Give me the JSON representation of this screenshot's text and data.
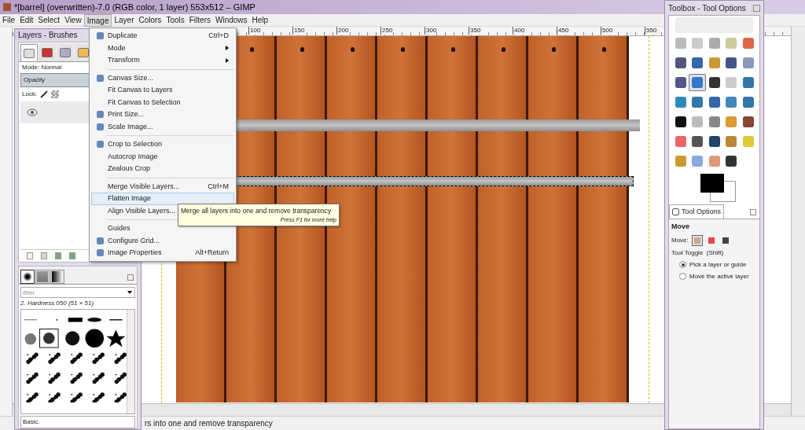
{
  "window": {
    "title": "*[barrel] (overwritten)-7.0 (RGB color, 1 layer) 553x512 – GIMP"
  },
  "menubar": [
    {
      "label": "File",
      "selected": false
    },
    {
      "label": "Edit",
      "selected": false
    },
    {
      "label": "Select",
      "selected": false
    },
    {
      "label": "View",
      "selected": false
    },
    {
      "label": "Image",
      "selected": true
    },
    {
      "label": "Layer",
      "selected": false
    },
    {
      "label": "Colors",
      "selected": false
    },
    {
      "label": "Tools",
      "selected": false
    },
    {
      "label": "Filters",
      "selected": false
    },
    {
      "label": "Windows",
      "selected": false
    },
    {
      "label": "Help",
      "selected": false
    }
  ],
  "layers_dock": {
    "title": "Layers - Brushes",
    "tabs": [
      {
        "selected": true
      },
      {
        "selected": false
      },
      {
        "selected": false
      },
      {
        "selected": false
      }
    ],
    "mode": "Mode: Normal",
    "opacity": {
      "label": "Opacity",
      "level": 1
    },
    "lock": "Lock:",
    "layer_visible": true,
    "brush_tabs": [
      {
        "selected": true
      },
      {
        "selected": false
      },
      {
        "selected": false
      }
    ],
    "filter_placeholder": "filter",
    "brush_name": "2. Hardness 050 (51 × 51)",
    "preset": "Basic."
  },
  "image_menu": [
    {
      "kind": "item",
      "label": "Duplicate",
      "shortcut": "Ctrl+D",
      "has_icon": true,
      "submenu": false,
      "highlighted": false
    },
    {
      "kind": "item",
      "label": "Mode",
      "has_icon": false,
      "submenu": true,
      "highlighted": false
    },
    {
      "kind": "item",
      "label": "Transform",
      "has_icon": false,
      "submenu": true,
      "highlighted": false
    },
    {
      "kind": "separator"
    },
    {
      "kind": "item",
      "label": "Canvas Size...",
      "has_icon": true,
      "submenu": false,
      "highlighted": false
    },
    {
      "kind": "item",
      "label": "Fit Canvas to Layers",
      "has_icon": false,
      "submenu": false,
      "highlighted": false
    },
    {
      "kind": "item",
      "label": "Fit Canvas to Selection",
      "has_icon": false,
      "submenu": false,
      "highlighted": false
    },
    {
      "kind": "item",
      "label": "Print Size...",
      "has_icon": true,
      "submenu": false,
      "highlighted": false
    },
    {
      "kind": "item",
      "label": "Scale Image...",
      "has_icon": true,
      "submenu": false,
      "highlighted": false
    },
    {
      "kind": "separator"
    },
    {
      "kind": "item",
      "label": "Crop to Selection",
      "has_icon": true,
      "submenu": false,
      "highlighted": false
    },
    {
      "kind": "item",
      "label": "Autocrop Image",
      "has_icon": false,
      "submenu": false,
      "highlighted": false
    },
    {
      "kind": "item",
      "label": "Zealous Crop",
      "has_icon": false,
      "submenu": false,
      "highlighted": false
    },
    {
      "kind": "separator"
    },
    {
      "kind": "item",
      "label": "Merge Visible Layers...",
      "shortcut": "Ctrl+M",
      "has_icon": false,
      "submenu": false,
      "highlighted": false
    },
    {
      "kind": "item",
      "label": "Flatten Image",
      "has_icon": false,
      "submenu": false,
      "highlighted": true
    },
    {
      "kind": "item",
      "label": "Align Visible Layers...",
      "has_icon": false,
      "submenu": false,
      "highlighted": false
    },
    {
      "kind": "separator"
    },
    {
      "kind": "item",
      "label": "Guides",
      "has_icon": false,
      "submenu": false,
      "highlighted": false
    },
    {
      "kind": "item",
      "label": "Configure Grid...",
      "has_icon": true,
      "submenu": false,
      "highlighted": false
    },
    {
      "kind": "item",
      "label": "Image Properties",
      "shortcut": "Alt+Return",
      "has_icon": true,
      "submenu": false,
      "highlighted": false
    }
  ],
  "tooltip": {
    "text": "Merge all layers into one and remove transparency",
    "help": "Press F1 for more help"
  },
  "ruler_labels": [
    "100",
    "150",
    "200",
    "250",
    "300",
    "350",
    "400",
    "450",
    "500",
    "550"
  ],
  "status_bar": {
    "text": "rs into one and remove transparency"
  },
  "toolbox": {
    "title": "Toolbox - Tool Options",
    "tools": [
      {
        "selected": false
      },
      {
        "selected": false
      },
      {
        "selected": false
      },
      {
        "selected": false
      },
      {
        "selected": false
      },
      {
        "selected": false
      },
      {
        "selected": false
      },
      {
        "selected": false
      },
      {
        "selected": false
      },
      {
        "selected": false
      },
      {
        "selected": false
      },
      {
        "selected": true
      },
      {
        "selected": false
      },
      {
        "selected": false
      },
      {
        "selected": false
      },
      {
        "selected": false
      },
      {
        "selected": false
      },
      {
        "selected": false
      },
      {
        "selected": false
      },
      {
        "selected": false
      },
      {
        "selected": false
      },
      {
        "selected": false
      },
      {
        "selected": false
      },
      {
        "selected": false
      },
      {
        "selected": false
      },
      {
        "selected": false
      },
      {
        "selected": false
      },
      {
        "selected": false
      },
      {
        "selected": false
      },
      {
        "selected": false
      },
      {
        "selected": false
      },
      {
        "selected": false
      },
      {
        "selected": false
      },
      {
        "selected": false
      }
    ],
    "options_tab": "Tool Options",
    "tool_name": "Move",
    "move_label": "Move:",
    "move_modes": [
      {
        "selected": true
      },
      {
        "selected": false
      },
      {
        "selected": false
      }
    ],
    "toggle_label": "Tool Toggle  (Shift)",
    "toggle_options": [
      {
        "label": "Pick a layer or guide",
        "selected": true
      },
      {
        "label": "Move the active layer",
        "selected": false
      }
    ]
  }
}
